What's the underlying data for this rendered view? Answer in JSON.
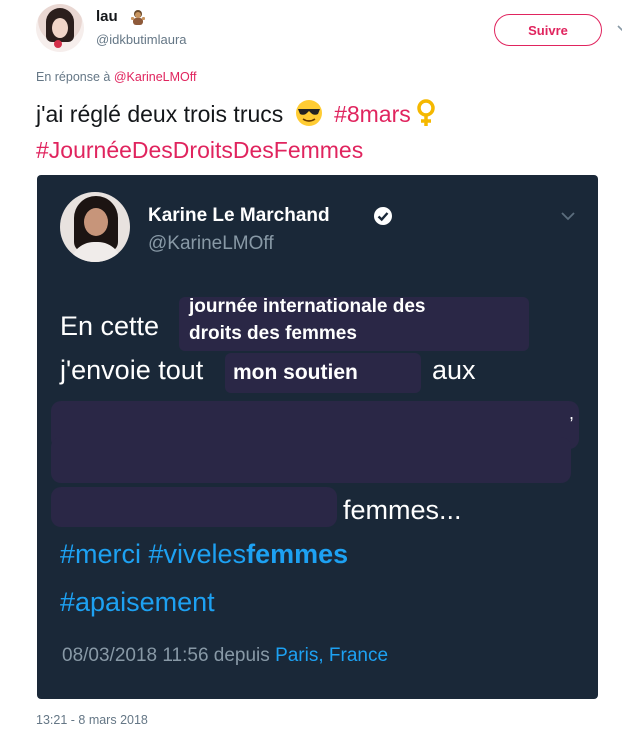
{
  "author": {
    "name": "lau",
    "handle": "@idkbutimlaura",
    "emoji": "person-gesturing-icon"
  },
  "follow_button": {
    "label": "Suivre"
  },
  "reply": {
    "prefix": "En réponse à",
    "mention": "@KarineLMOff"
  },
  "tweet": {
    "text": "j'ai réglé deux trois trucs",
    "emoji": "smiling-face-with-sunglasses-icon",
    "hashtag1": "#8mars",
    "emoji2": "female-sign-icon",
    "hashtag2": "#JournéeDesDroitsDesFemmes"
  },
  "embedded": {
    "name": "Karine Le Marchand",
    "handle": "@KarineLMOff",
    "line1_start": "En cette",
    "overlay1_line1": "journée internationale des",
    "overlay1_line2": "droits des femmes",
    "line2_start": "j'envoie tout",
    "overlay2": "mon soutien",
    "line2_end": "aux",
    "comma": ",",
    "femmes": "femmes...",
    "tag_merci": "#merci",
    "tag_vivele_prefix": "#viveles",
    "tag_vivele_bold": "femmes",
    "tag_apaisement": "#apaisement",
    "date": "08/03/2018 11:56 depuis",
    "place": "Paris, France"
  },
  "timestamp": "13:21 - 8 mars 2018",
  "colors": {
    "accent": "#e0245e",
    "link_blue": "#1da1f2",
    "card_bg": "#1a2838"
  }
}
